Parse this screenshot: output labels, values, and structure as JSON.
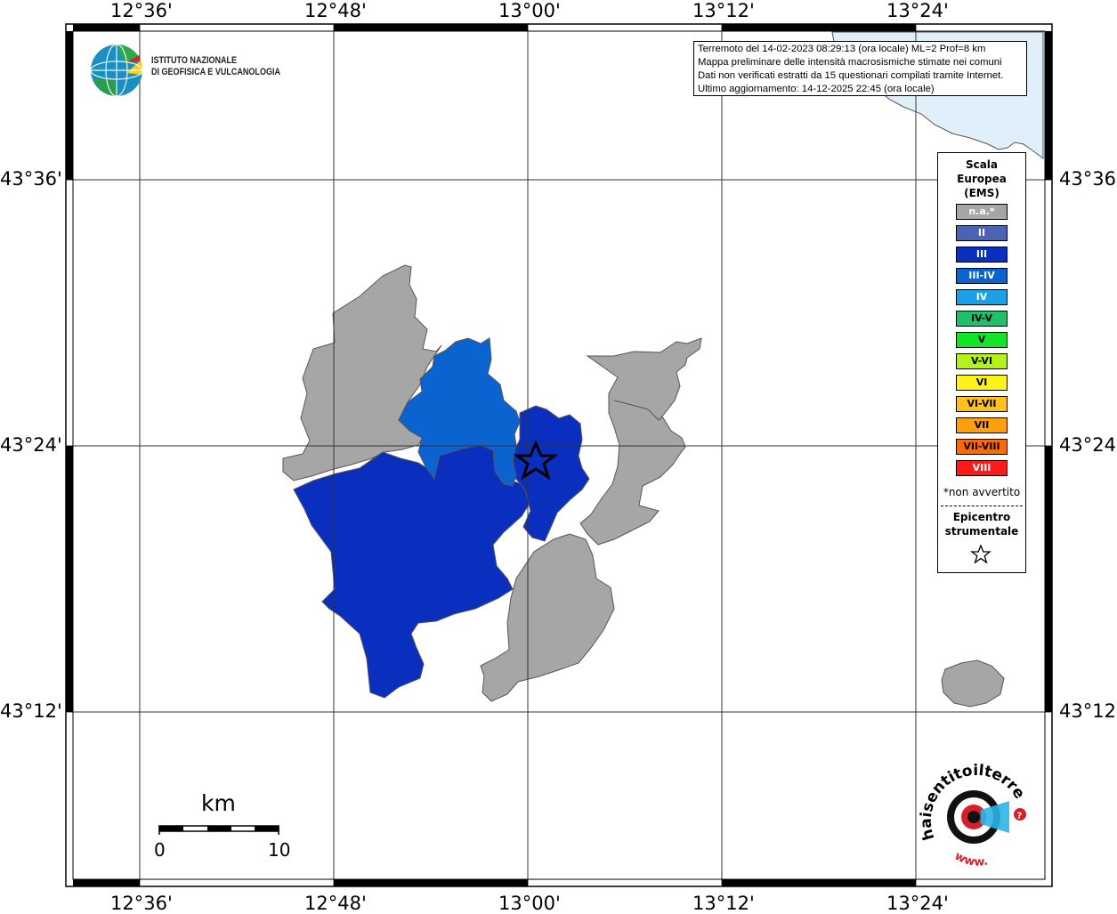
{
  "info_box": {
    "line1": "Terremoto del 14-02-2023 08:29:13 (ora locale) ML=2 Prof=8 km",
    "line2": "Mappa preliminare delle intensità macrosismiche stimate nei comuni",
    "line3": "Dati non verificati estratti da 15 questionari compilati tramite Internet.",
    "line4": "Ultimo aggiornamento: 14-12-2025 22:45 (ora locale)"
  },
  "ingv": {
    "line1": "ISTITUTO NAZIONALE",
    "line2": "DI GEOFISICA E VULCANOLOGIA"
  },
  "axes": {
    "lon_labels": [
      "12°36'",
      "12°48'",
      "13°00'",
      "13°12'",
      "13°24'"
    ],
    "lat_labels": [
      "43°36'",
      "43°24'",
      "43°12'"
    ]
  },
  "legend": {
    "title_line1": "Scala",
    "title_line2": "Europea",
    "title_line3": "(EMS)",
    "items": [
      {
        "label": "n.a.*",
        "color": "#a6a6a6",
        "text_color": "#ffffff"
      },
      {
        "label": "II",
        "color": "#4b63b4",
        "text_color": "#ffffff"
      },
      {
        "label": "III",
        "color": "#0a2fbf",
        "text_color": "#ffffff"
      },
      {
        "label": "III-IV",
        "color": "#0a63cf",
        "text_color": "#ffffff"
      },
      {
        "label": "IV",
        "color": "#1aa0e6",
        "text_color": "#ffffff"
      },
      {
        "label": "IV-V",
        "color": "#1fbf6b",
        "text_color": "#000000"
      },
      {
        "label": "V",
        "color": "#10e626",
        "text_color": "#000000"
      },
      {
        "label": "V-VI",
        "color": "#b3f21a",
        "text_color": "#000000"
      },
      {
        "label": "VI",
        "color": "#fff21a",
        "text_color": "#000000"
      },
      {
        "label": "VI-VII",
        "color": "#ffc21a",
        "text_color": "#000000"
      },
      {
        "label": "VII",
        "color": "#ff9f0d",
        "text_color": "#000000"
      },
      {
        "label": "VII-VIII",
        "color": "#ff6a00",
        "text_color": "#000000"
      },
      {
        "label": "VIII",
        "color": "#ff1a1a",
        "text_color": "#ffffff"
      }
    ],
    "note": "*non avvertito",
    "epicenter_line1": "Epicentro",
    "epicenter_line2": "strumentale"
  },
  "scale_bar": {
    "unit": "km",
    "start": "0",
    "end": "10"
  },
  "hst": {
    "brand": "haisentitoilterremoto.it",
    "www": "www."
  },
  "colors": {
    "na": "#a6a6a6",
    "iii": "#0a2fbf",
    "iii_iv": "#0a63cf",
    "sea": "#dff0fb",
    "border": "#555555"
  }
}
